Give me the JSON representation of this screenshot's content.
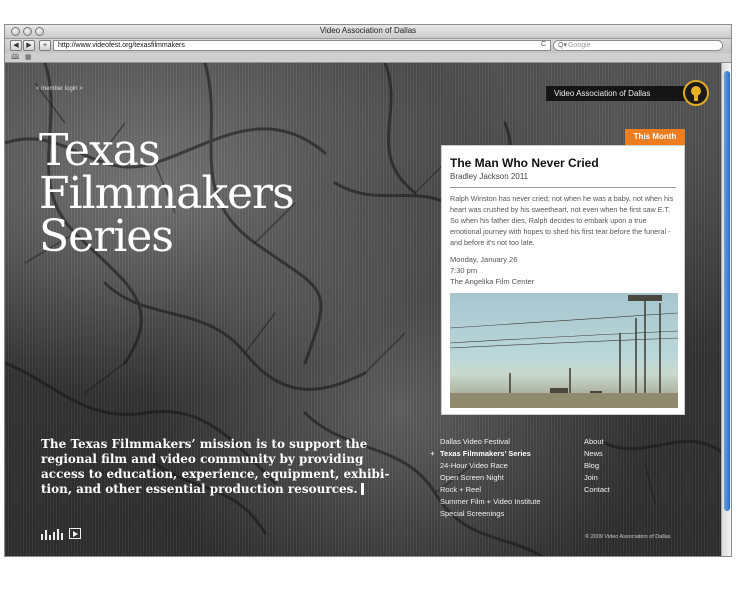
{
  "browser": {
    "title": "Video Association of Dallas",
    "back_label": "◀",
    "forward_label": "▶",
    "add_label": "+",
    "url": "http://www.videofest.org/texasfilmmakers",
    "reload_label": "C",
    "search_placeholder": "Google",
    "search_glyph": "Q▾"
  },
  "header": {
    "member_login": "< member login >",
    "org_name": "Video Association of Dallas"
  },
  "hero": {
    "lines": [
      "Texas",
      "Filmmakers",
      "Series"
    ]
  },
  "mission": {
    "lines": [
      "The Texas Filmmakers’ mission is to support the",
      "regional film and video community by providing",
      "access to education, experience, equipment, exhibi-",
      "tion, and other essential production resources."
    ]
  },
  "card": {
    "badge": "This Month",
    "title": "The Man Who Never Cried",
    "subtitle": "Bradley Jackson 2011",
    "description": "Ralph Winston has never cried; not when he was a baby, not when his heart was crushed by his sweetheart, not even when he first saw E.T. So when his father dies, Ralph decides to embark upon a true emotional journey with hopes to shed his first tear before the funeral - and before it’s not too late.",
    "date": "Monday, January 26",
    "time": "7:30 pm",
    "venue": "The Angelika Film Center"
  },
  "nav": {
    "bullet": "+",
    "left": [
      "Dallas Video Festival",
      "Texas Filmmakers’ Series",
      "24-Hour Video Race",
      "Open Screen Night",
      "Rock + Reel",
      "Summer Film + Video Institute",
      "Special Screenings"
    ],
    "right": [
      "About",
      "News",
      "Blog",
      "Join",
      "Contact"
    ]
  },
  "footer": {
    "copyright": "© 2009 Video Association of Dallas"
  },
  "colors": {
    "accent": "#ee7d1f",
    "logo_gold": "#e8b322"
  },
  "icons": [
    "traffic-light-icon",
    "reload-icon",
    "search-icon",
    "bookmarks-icon",
    "grid-icon",
    "equalizer-icon",
    "play-icon",
    "vad-logo-icon"
  ]
}
